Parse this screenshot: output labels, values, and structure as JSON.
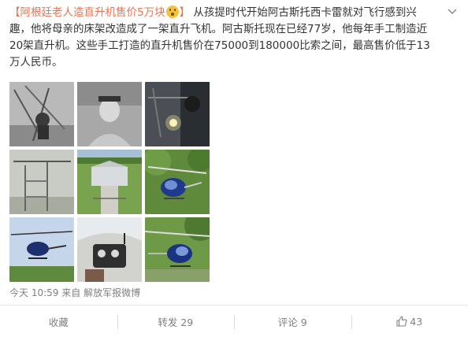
{
  "post": {
    "title": "【阿根廷老人造直升机售价5万块",
    "title_end": "】",
    "body_line1": "从孩提时代开始阿古斯托西卡雷就对飞行感到兴",
    "body_line2": "趣，他将母亲的床架改造成了一架直升飞机。阿古斯托现在已经77岁，他每年手工制造近",
    "body_line3": "20架直升机。这些手工打造的直升机售价在75000到180000比索之间，最高售价低于13",
    "body_line4": "万人民币。"
  },
  "images": [
    {
      "label": "workshop-photo-1"
    },
    {
      "label": "old-man-portrait"
    },
    {
      "label": "welding-photo"
    },
    {
      "label": "frame-photo"
    },
    {
      "label": "hangar-aerial"
    },
    {
      "label": "helicopter-trees"
    },
    {
      "label": "helicopter-flying"
    },
    {
      "label": "cockpit-photo"
    },
    {
      "label": "helicopter-ground"
    }
  ],
  "meta": {
    "time": "今天 10:59",
    "source_prefix": "来自",
    "source": "解放军报微博"
  },
  "actions": {
    "favorite": "收藏",
    "repost": "转发 29",
    "comment": "评论 9",
    "like": "43"
  },
  "colors": {
    "accent": "#eb7350",
    "muted": "#808080",
    "text": "#333333"
  }
}
